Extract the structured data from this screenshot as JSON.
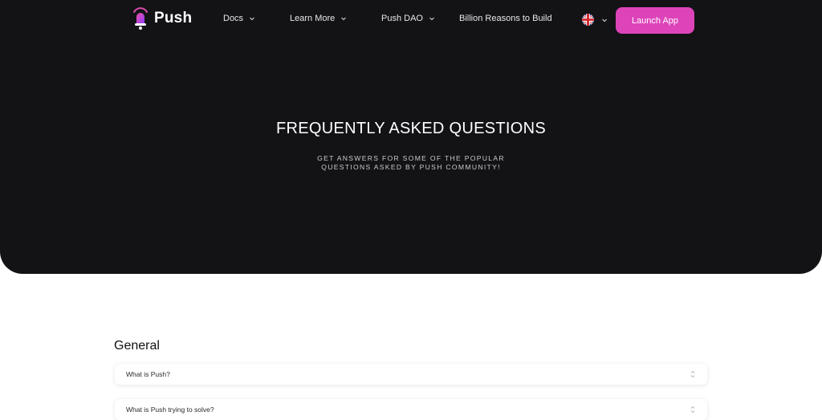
{
  "brand": {
    "name": "Push",
    "accent": "#dd44b9",
    "logo_icon": "bell-icon"
  },
  "nav": {
    "items": [
      {
        "label": "Docs",
        "has_dropdown": true
      },
      {
        "label": "Learn More",
        "has_dropdown": true
      },
      {
        "label": "Push DAO",
        "has_dropdown": true
      },
      {
        "label": "Billion Reasons to Build",
        "has_dropdown": false
      }
    ],
    "language_icon": "uk-flag-icon",
    "launch_label": "Launch App"
  },
  "hero": {
    "title": "FREQUENTLY ASKED QUESTIONS",
    "subtitle": "GET ANSWERS FOR SOME OF THE POPULAR QUESTIONS ASKED BY PUSH COMMUNITY!",
    "background": "#131316"
  },
  "faq": {
    "section_title": "General",
    "questions": [
      "What is Push?",
      "What is Push trying to solve?"
    ]
  }
}
